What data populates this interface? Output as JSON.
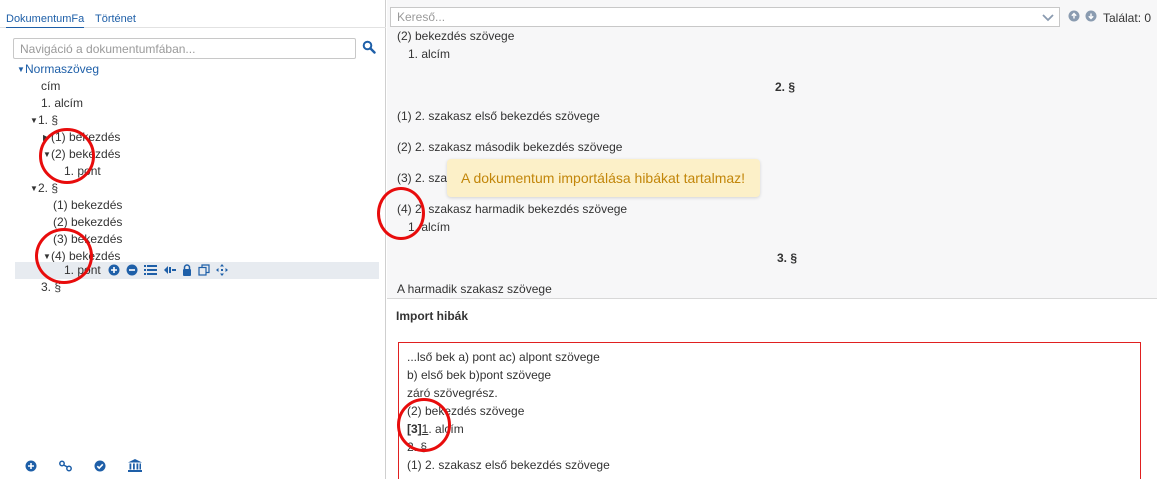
{
  "left_panel": {
    "tabs": [
      {
        "label": "DokumentumFa"
      },
      {
        "label": "Történet"
      }
    ],
    "nav_search": {
      "placeholder": "Navigáció a dokumentumfában...",
      "icon": "search-icon"
    },
    "tree": [
      {
        "label": "Normaszöveg",
        "caret": "▼"
      },
      {
        "label": "cím"
      },
      {
        "label": "1. alcím"
      },
      {
        "label": "1. §",
        "caret": "▼"
      },
      {
        "label": "(1) bekezdés",
        "caret": "▶"
      },
      {
        "label": "(2) bekezdés",
        "caret": "▼"
      },
      {
        "label": "1. pont"
      },
      {
        "label": "2. §",
        "caret": "▼"
      },
      {
        "label": "(1) bekezdés"
      },
      {
        "label": "(2) bekezdés"
      },
      {
        "label": "(3) bekezdés"
      },
      {
        "label": "(4) bekezdés",
        "caret": "▼"
      },
      {
        "label": "1. pont"
      },
      {
        "label": "3. §"
      }
    ],
    "row_tools": [
      "plus-circle-icon",
      "minus-circle-icon",
      "list-icon",
      "reorder-icon",
      "lock-icon",
      "copy-icon",
      "move-icon"
    ],
    "bottom_tools": [
      "add-icon",
      "link-icon",
      "check-icon",
      "institution-icon"
    ]
  },
  "search": {
    "placeholder": "Kereső...",
    "hits_label": "Találat: 0"
  },
  "document": {
    "lines": [
      {
        "text": "(2) bekezdés szövege"
      },
      {
        "text": "1. alcím"
      },
      {
        "text": "2. §"
      },
      {
        "text": "(1) 2. szakasz első bekezdés szövege"
      },
      {
        "text": "(2) 2. szakasz második bekezdés szövege"
      },
      {
        "text": "(3) 2. szal"
      },
      {
        "text": "(4) 2. szakasz harmadik bekezdés szövege"
      },
      {
        "text": "1. alcím"
      },
      {
        "text": "3. §"
      },
      {
        "text": "A harmadik szakasz szövege"
      }
    ]
  },
  "toast": {
    "message": "A dokumentum importálása hibákat tartalmaz!"
  },
  "import_errors": {
    "title": "Import hibák",
    "lines": [
      {
        "text": "...lső bek a) pont ac) alpont szövege"
      },
      {
        "text": "b) első bek b)pont szövege"
      },
      {
        "text": "záró szövegrész."
      },
      {
        "text": "(2) bekezdés szövege"
      },
      {
        "prefix": "[3]",
        "marker": "1",
        "rest": ". alcím"
      },
      {
        "text": "2. §"
      },
      {
        "text": "(1) 2. szakasz első bekezdés szövege"
      }
    ]
  },
  "colors": {
    "accent": "#1e5fa8",
    "annotation": "#e80c0c",
    "toast_bg": "#fcf0c8",
    "toast_text": "#c2860a",
    "error_border": "#e02020"
  }
}
